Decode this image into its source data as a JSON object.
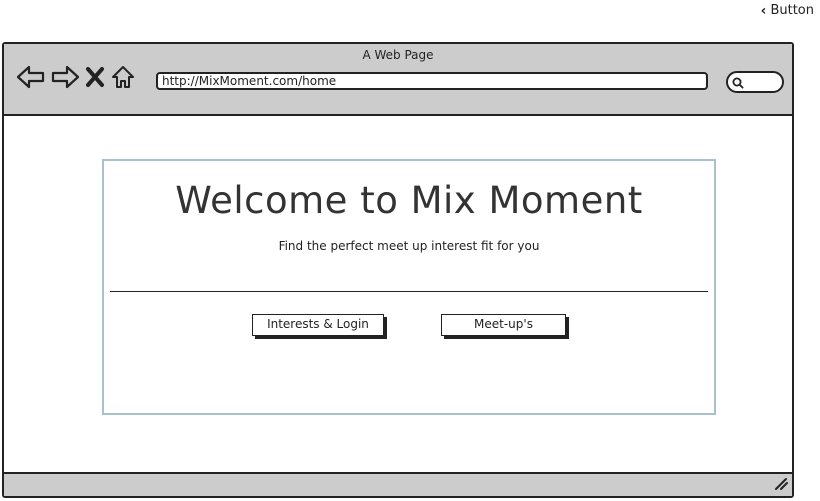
{
  "top_link": {
    "label": "Button"
  },
  "browser": {
    "window_title": "A Web Page",
    "url": "http://MixMoment.com/home",
    "nav_icons": [
      "back-arrow-icon",
      "forward-arrow-icon",
      "close-x-icon",
      "home-icon"
    ],
    "search_icon": "search-icon"
  },
  "main": {
    "headline": "Welcome to Mix Moment",
    "subheadline": "Find the perfect meet up interest fit for you",
    "buttons": [
      {
        "label": "Interests & Login"
      },
      {
        "label": "Meet-up's"
      }
    ]
  },
  "colors": {
    "chrome_gray": "#cccccc",
    "panel_border": "#a9c1cc",
    "ink": "#222222"
  }
}
